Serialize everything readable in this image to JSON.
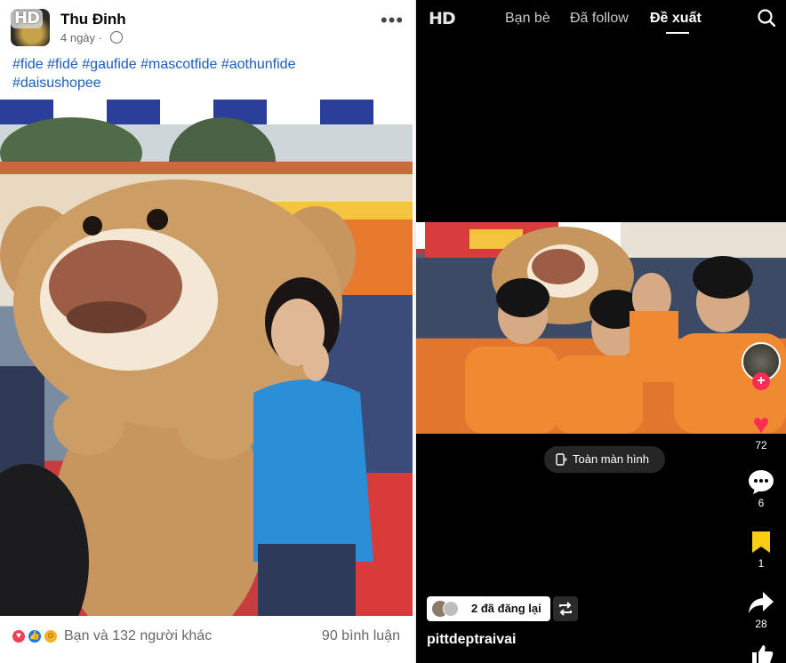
{
  "facebook": {
    "author_name": "Thu Đinh",
    "timestamp": "4 ngày ·",
    "caption_line1": "#fide #fidé #gaufide #mascotfide #aothunfide",
    "caption_line2": "#daisushopee",
    "likes_text": "Bạn và 132 người khác",
    "comments_text": "90 bình luận"
  },
  "tiktok": {
    "badge": "HD",
    "tabs": [
      "Bạn bè",
      "Đã follow",
      "Đề xuất"
    ],
    "active_tab": "Đề xuất",
    "fullscreen_label": "Toàn màn hình",
    "likes": "72",
    "comments": "6",
    "saves": "1",
    "shares": "28",
    "repost_label": "2 đã đăng lại",
    "username": "pittdeptraivai"
  },
  "badges": {
    "hd": "HD"
  },
  "colors": {
    "facebook_link": "#1b5fb8",
    "tiktok_like": "#fe2c55",
    "tiktok_save": "#facc15"
  }
}
